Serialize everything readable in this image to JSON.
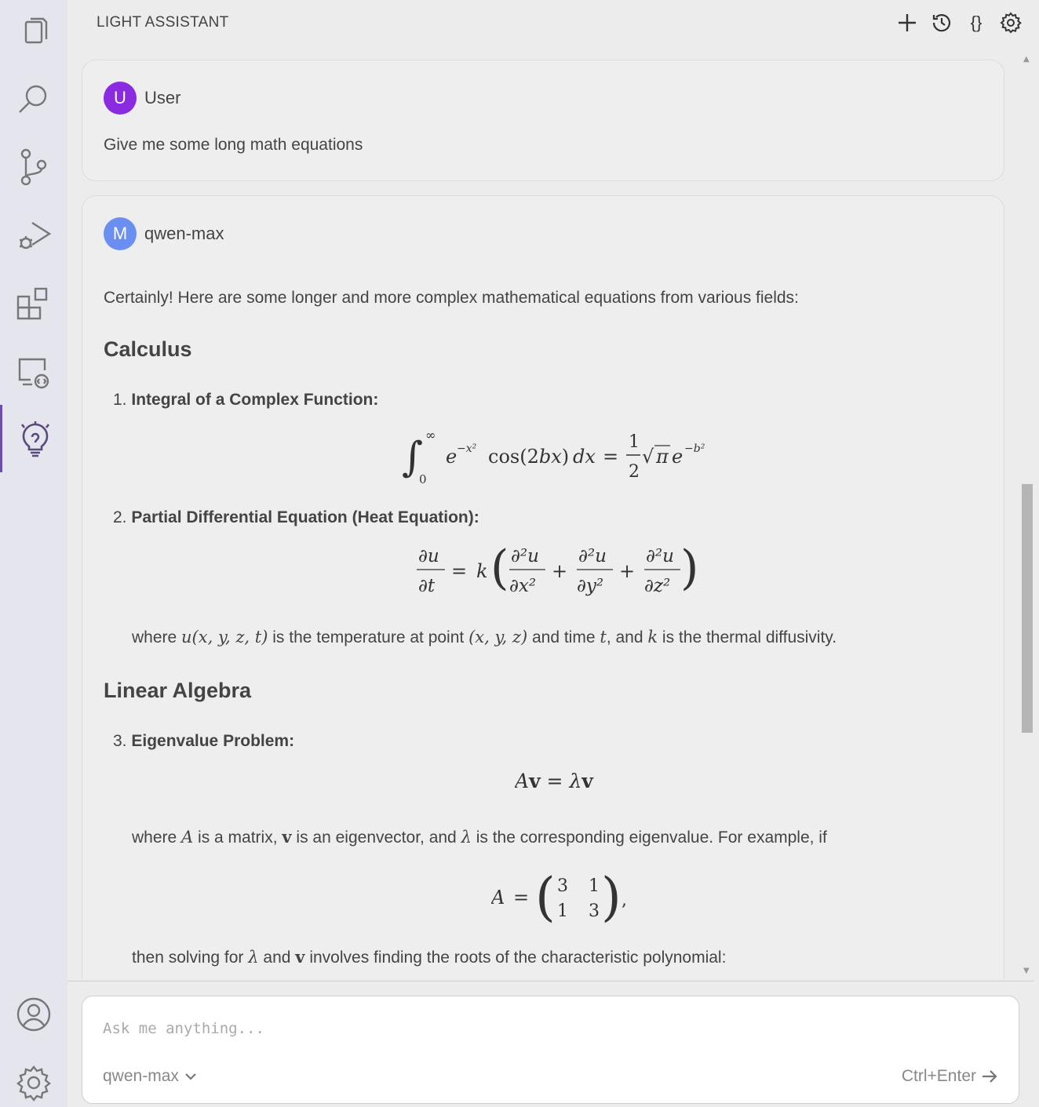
{
  "header": {
    "title": "LIGHT ASSISTANT",
    "actions": [
      {
        "icon": "plus-icon"
      },
      {
        "icon": "history-icon"
      },
      {
        "icon": "braces-icon",
        "label": "{}"
      },
      {
        "icon": "gear-icon"
      }
    ]
  },
  "activity_bar": {
    "items": [
      {
        "icon": "files-icon"
      },
      {
        "icon": "search-icon"
      },
      {
        "icon": "source-control-icon"
      },
      {
        "icon": "run-debug-icon"
      },
      {
        "icon": "extensions-icon"
      },
      {
        "icon": "remote-explorer-icon"
      },
      {
        "icon": "light-assistant-icon",
        "active": true
      }
    ],
    "bottom": [
      {
        "icon": "account-icon"
      },
      {
        "icon": "settings-icon"
      }
    ]
  },
  "messages": {
    "user": {
      "avatar_letter": "U",
      "name": "User",
      "text": "Give me some long math equations"
    },
    "assistant": {
      "avatar_letter": "M",
      "name": "qwen-max",
      "intro": "Certainly! Here are some longer and more complex mathematical equations from various fields:",
      "section1": "Calculus",
      "item1_num": "1.",
      "item1_title": "Integral of a Complex Function:",
      "item2_num": "2.",
      "item2_title": "Partial Differential Equation (Heat Equation):",
      "item2_note_a": "where ",
      "item2_note_b": " is the temperature at point ",
      "item2_note_c": " and time ",
      "item2_note_d": ", and ",
      "item2_note_e": " is the thermal diffusivity.",
      "section2": "Linear Algebra",
      "item3_num": "3.",
      "item3_title": "Eigenvalue Problem:",
      "item3_note_a": "where ",
      "item3_note_b": " is a matrix, ",
      "item3_note_c": " is an eigenvector, and ",
      "item3_note_d": " is the corresponding eigenvalue. For example, if",
      "item3_after_a": "then solving for ",
      "item3_after_b": " and ",
      "item3_after_c": " involves finding the roots of the characteristic polynomial:"
    }
  },
  "input": {
    "placeholder": "Ask me anything...",
    "model": "qwen-max",
    "send_hint": "Ctrl+Enter"
  },
  "colors": {
    "accent": "#6b4fa8",
    "user_avatar": "#8a2be2",
    "model_avatar": "#6b8ff0"
  }
}
